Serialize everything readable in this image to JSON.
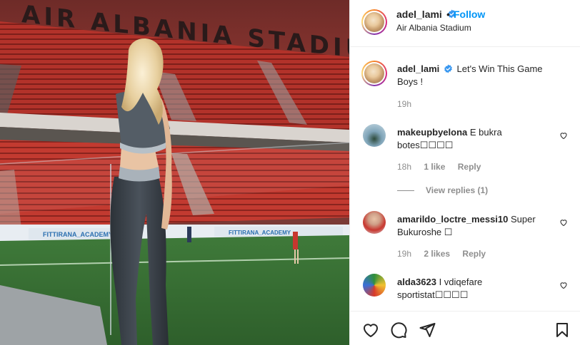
{
  "photo": {
    "banner_text": "AIR ALBANIA STADIU",
    "ad_board_text": "FITTIRANA_ACADEMY"
  },
  "header": {
    "username": "adel_lami",
    "separator": "•",
    "follow_label": "Follow",
    "location": "Air Albania Stadium",
    "more_icon": "more-horizontal-icon"
  },
  "caption": {
    "username": "adel_lami",
    "text": "Let's Win This Game Boys !",
    "time": "19h"
  },
  "comments": [
    {
      "username": "makeupbyelona",
      "text": "E bukra botes☐☐☐☐",
      "time": "18h",
      "likes": "1 like",
      "reply_label": "Reply",
      "view_replies": "View replies (1)"
    },
    {
      "username": "amarildo_loctre_messi10",
      "text": "Super Bukuroshe ☐",
      "time": "19h",
      "likes": "2 likes",
      "reply_label": "Reply"
    },
    {
      "username": "alda3623",
      "text": "I vdiqefare sportistat☐☐☐☐"
    }
  ],
  "actions": {
    "like_icon": "heart-icon",
    "comment_icon": "comment-icon",
    "share_icon": "share-icon",
    "save_icon": "bookmark-icon"
  },
  "colors": {
    "link_blue": "#0095f6",
    "verified_blue": "#3897f0",
    "muted": "#8e8e8e",
    "text": "#262626",
    "stadium_red": "#b8332b"
  }
}
